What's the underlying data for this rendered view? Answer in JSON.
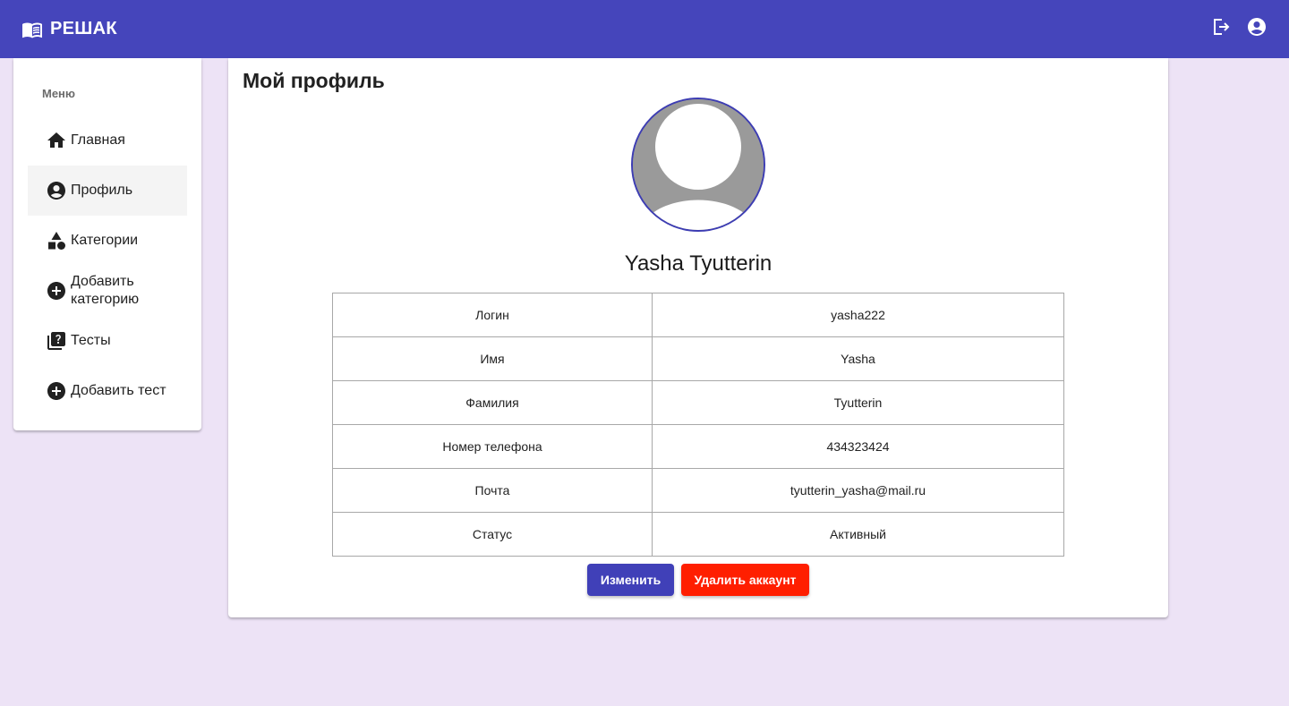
{
  "colors": {
    "accent": "#4545bb",
    "danger": "#ff1f00",
    "background": "#ede3f6"
  },
  "header": {
    "brand": "РЕШАК",
    "brand_icon": "menu-book-icon",
    "logout_icon": "logout-icon",
    "account_icon": "account-circle-icon"
  },
  "sidebar": {
    "title": "Меню",
    "items": [
      {
        "label": "Главная",
        "icon": "home-icon"
      },
      {
        "label": "Профиль",
        "icon": "account-circle-icon",
        "active": true
      },
      {
        "label": "Категории",
        "icon": "category-icon"
      },
      {
        "label": "Добавить категорию",
        "icon": "add-circle-icon"
      },
      {
        "label": "Тесты",
        "icon": "quiz-icon"
      },
      {
        "label": "Добавить тест",
        "icon": "add-circle-icon"
      }
    ]
  },
  "main": {
    "title": "Мой профиль",
    "user_name": "Yasha Tyutterin",
    "fields": [
      {
        "label": "Логин",
        "value": "yasha222"
      },
      {
        "label": "Имя",
        "value": "Yasha"
      },
      {
        "label": "Фамилия",
        "value": "Tyutterin"
      },
      {
        "label": "Номер телефона",
        "value": "434323424"
      },
      {
        "label": "Почта",
        "value": "tyutterin_yasha@mail.ru"
      },
      {
        "label": "Статус",
        "value": "Активный"
      }
    ],
    "edit_button": "Изменить",
    "delete_button": "Удалить аккаунт"
  }
}
